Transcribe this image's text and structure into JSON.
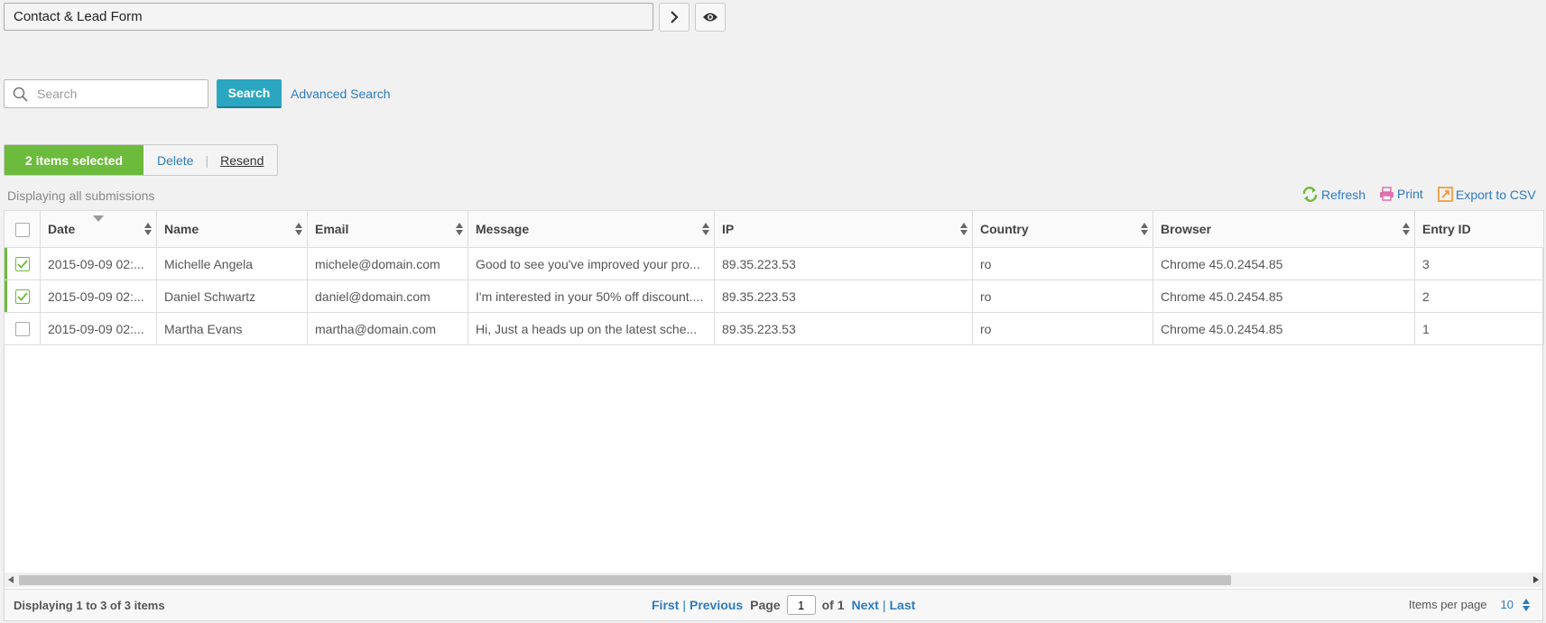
{
  "form_selector": {
    "value": "Contact & Lead Form"
  },
  "search": {
    "placeholder": "Search",
    "button_label": "Search",
    "advanced_label": "Advanced Search"
  },
  "selection": {
    "count_label": "2 items selected",
    "delete_label": "Delete",
    "resend_label": "Resend"
  },
  "status_text": "Displaying all submissions",
  "tools": {
    "refresh": "Refresh",
    "print": "Print",
    "export": "Export to CSV"
  },
  "colors": {
    "accent_green": "#6cbb3c",
    "search_button": "#2ba6c1",
    "link_blue": "#2c7bc0"
  },
  "table": {
    "columns": [
      "Date",
      "Name",
      "Email",
      "Message",
      "IP",
      "Country",
      "Browser",
      "Entry ID"
    ],
    "rows": [
      {
        "checked": true,
        "date": "2015-09-09 02:...",
        "name": "Michelle Angela",
        "email": "michele@domain.com",
        "message": "Good to see you've improved your pro...",
        "ip": "89.35.223.53",
        "country": "ro",
        "browser": "Chrome 45.0.2454.85",
        "entry_id": "3"
      },
      {
        "checked": true,
        "date": "2015-09-09 02:...",
        "name": "Daniel Schwartz",
        "email": "daniel@domain.com",
        "message": "I'm interested in your 50% off discount....",
        "ip": "89.35.223.53",
        "country": "ro",
        "browser": "Chrome 45.0.2454.85",
        "entry_id": "2"
      },
      {
        "checked": false,
        "date": "2015-09-09 02:...",
        "name": "Martha Evans",
        "email": "martha@domain.com",
        "message": "Hi, Just a heads up on the latest sche...",
        "ip": "89.35.223.53",
        "country": "ro",
        "browser": "Chrome 45.0.2454.85",
        "entry_id": "1"
      }
    ]
  },
  "footer": {
    "displaying": "Displaying 1 to 3 of 3 items",
    "first": "First",
    "previous": "Previous",
    "page_label": "Page",
    "page_value": "1",
    "of_label": "of 1",
    "next": "Next",
    "last": "Last",
    "items_per_page_label": "Items per page",
    "items_per_page_value": "10"
  }
}
